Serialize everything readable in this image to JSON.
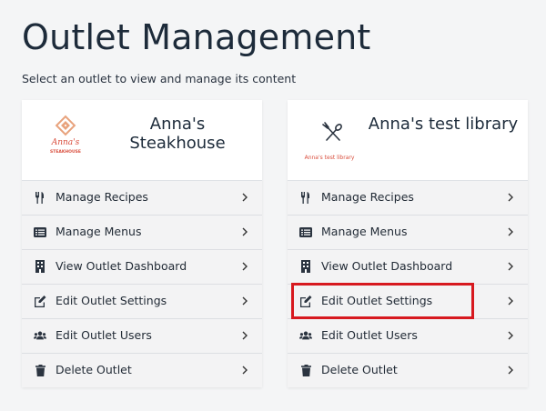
{
  "page": {
    "title": "Outlet Management",
    "subtitle": "Select an outlet to view and manage its content"
  },
  "outlets": [
    {
      "name": "Anna's Steakhouse",
      "logo": {
        "line1": "Anna's",
        "line2": "STEAKHOUSE",
        "color": "#d94d3c"
      },
      "menu": [
        {
          "label": "Manage Recipes",
          "icon": "utensils-icon"
        },
        {
          "label": "Manage Menus",
          "icon": "menu-list-icon"
        },
        {
          "label": "View Outlet Dashboard",
          "icon": "building-icon"
        },
        {
          "label": "Edit Outlet Settings",
          "icon": "edit-icon"
        },
        {
          "label": "Edit Outlet Users",
          "icon": "users-icon"
        },
        {
          "label": "Delete Outlet",
          "icon": "trash-icon"
        }
      ]
    },
    {
      "name": "Anna's test library",
      "logo": {
        "text": "Anna's test library",
        "color": "#d94d3c"
      },
      "menu": [
        {
          "label": "Manage Recipes",
          "icon": "utensils-icon"
        },
        {
          "label": "Manage Menus",
          "icon": "menu-list-icon"
        },
        {
          "label": "View Outlet Dashboard",
          "icon": "building-icon"
        },
        {
          "label": "Edit Outlet Settings",
          "icon": "edit-icon"
        },
        {
          "label": "Edit Outlet Users",
          "icon": "users-icon"
        },
        {
          "label": "Delete Outlet",
          "icon": "trash-icon"
        }
      ]
    }
  ],
  "colors": {
    "highlight": "#d7191f",
    "background": "#f4f5f6",
    "brand_logo": "#d94d3c"
  }
}
